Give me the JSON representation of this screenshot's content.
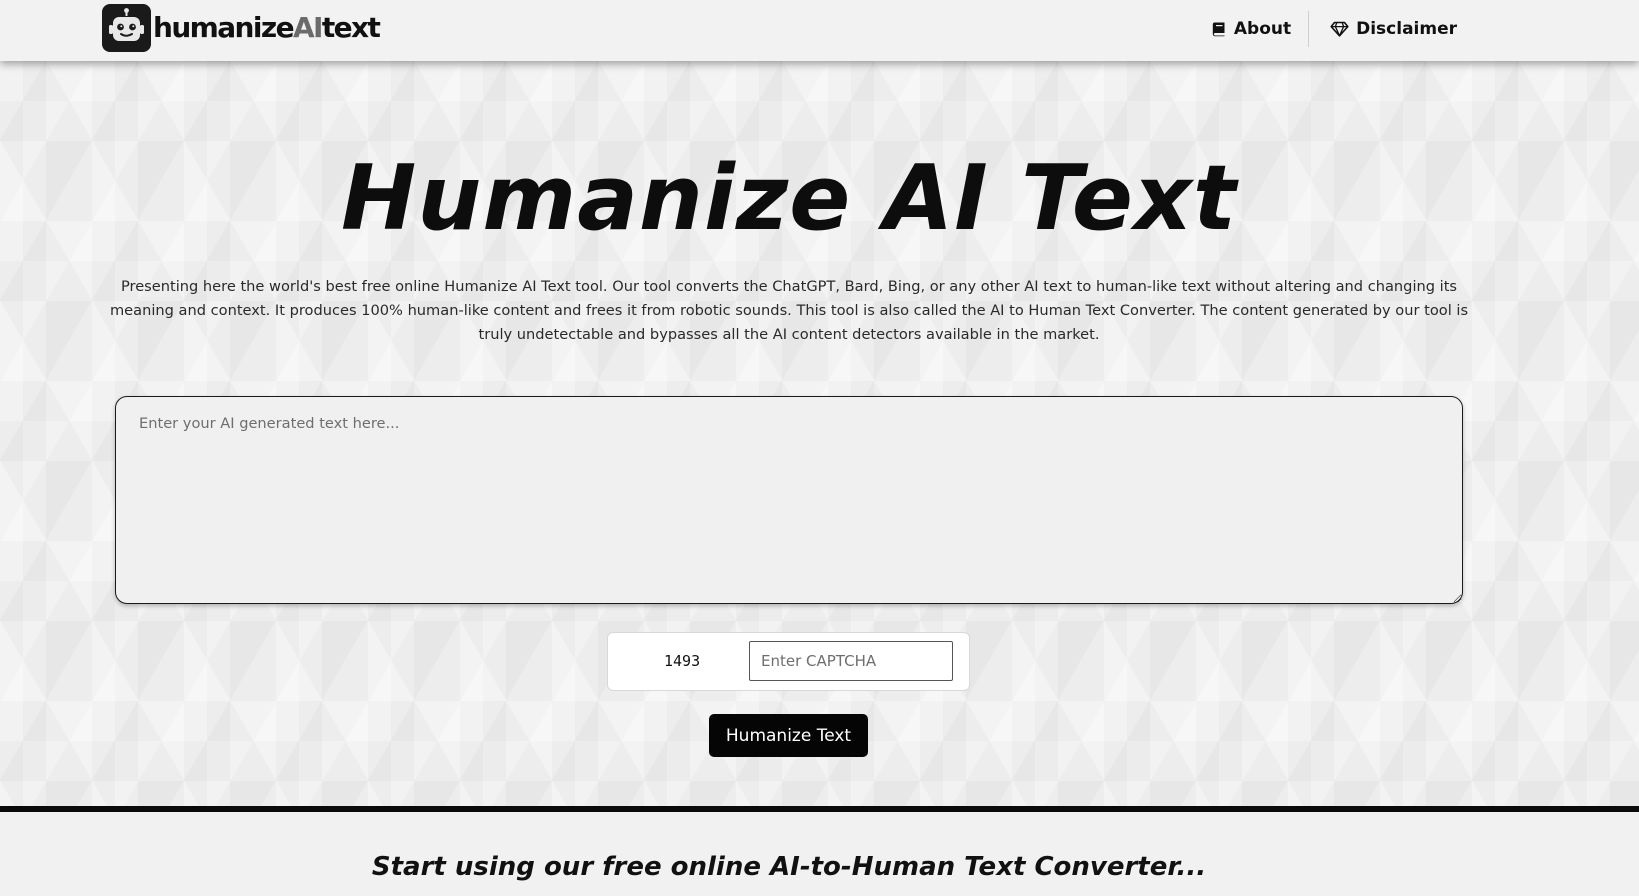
{
  "header": {
    "logo": {
      "word_prefix": "humanize",
      "word_ai": "AI",
      "word_suffix": "text"
    },
    "nav": {
      "about_label": "About",
      "about_icon": "book-icon",
      "disclaimer_label": "Disclaimer",
      "disclaimer_icon": "diamond-icon"
    }
  },
  "hero": {
    "title": "Humanize AI Text",
    "description": "Presenting here the world's best free online Humanize AI Text tool. Our tool converts the ChatGPT, Bard, Bing, or any other AI text to human-like text without altering and changing its meaning and context. It produces 100% human-like content and frees it from robotic sounds. This tool is also called the AI to Human Text Converter. The content generated by our tool is truly undetectable and bypasses all the AI content detectors available in the market.",
    "input_placeholder": "Enter your AI generated text here...",
    "input_value": "",
    "captcha": {
      "code": "1493",
      "placeholder": "Enter CAPTCHA",
      "value": ""
    },
    "submit_label": "Humanize Text"
  },
  "section": {
    "heading": "Start using our free online AI-to-Human Text Converter..."
  },
  "colors": {
    "accent": "#050505",
    "logo_ai": "#6b6b6b",
    "page_background": "#f0f0f0"
  }
}
